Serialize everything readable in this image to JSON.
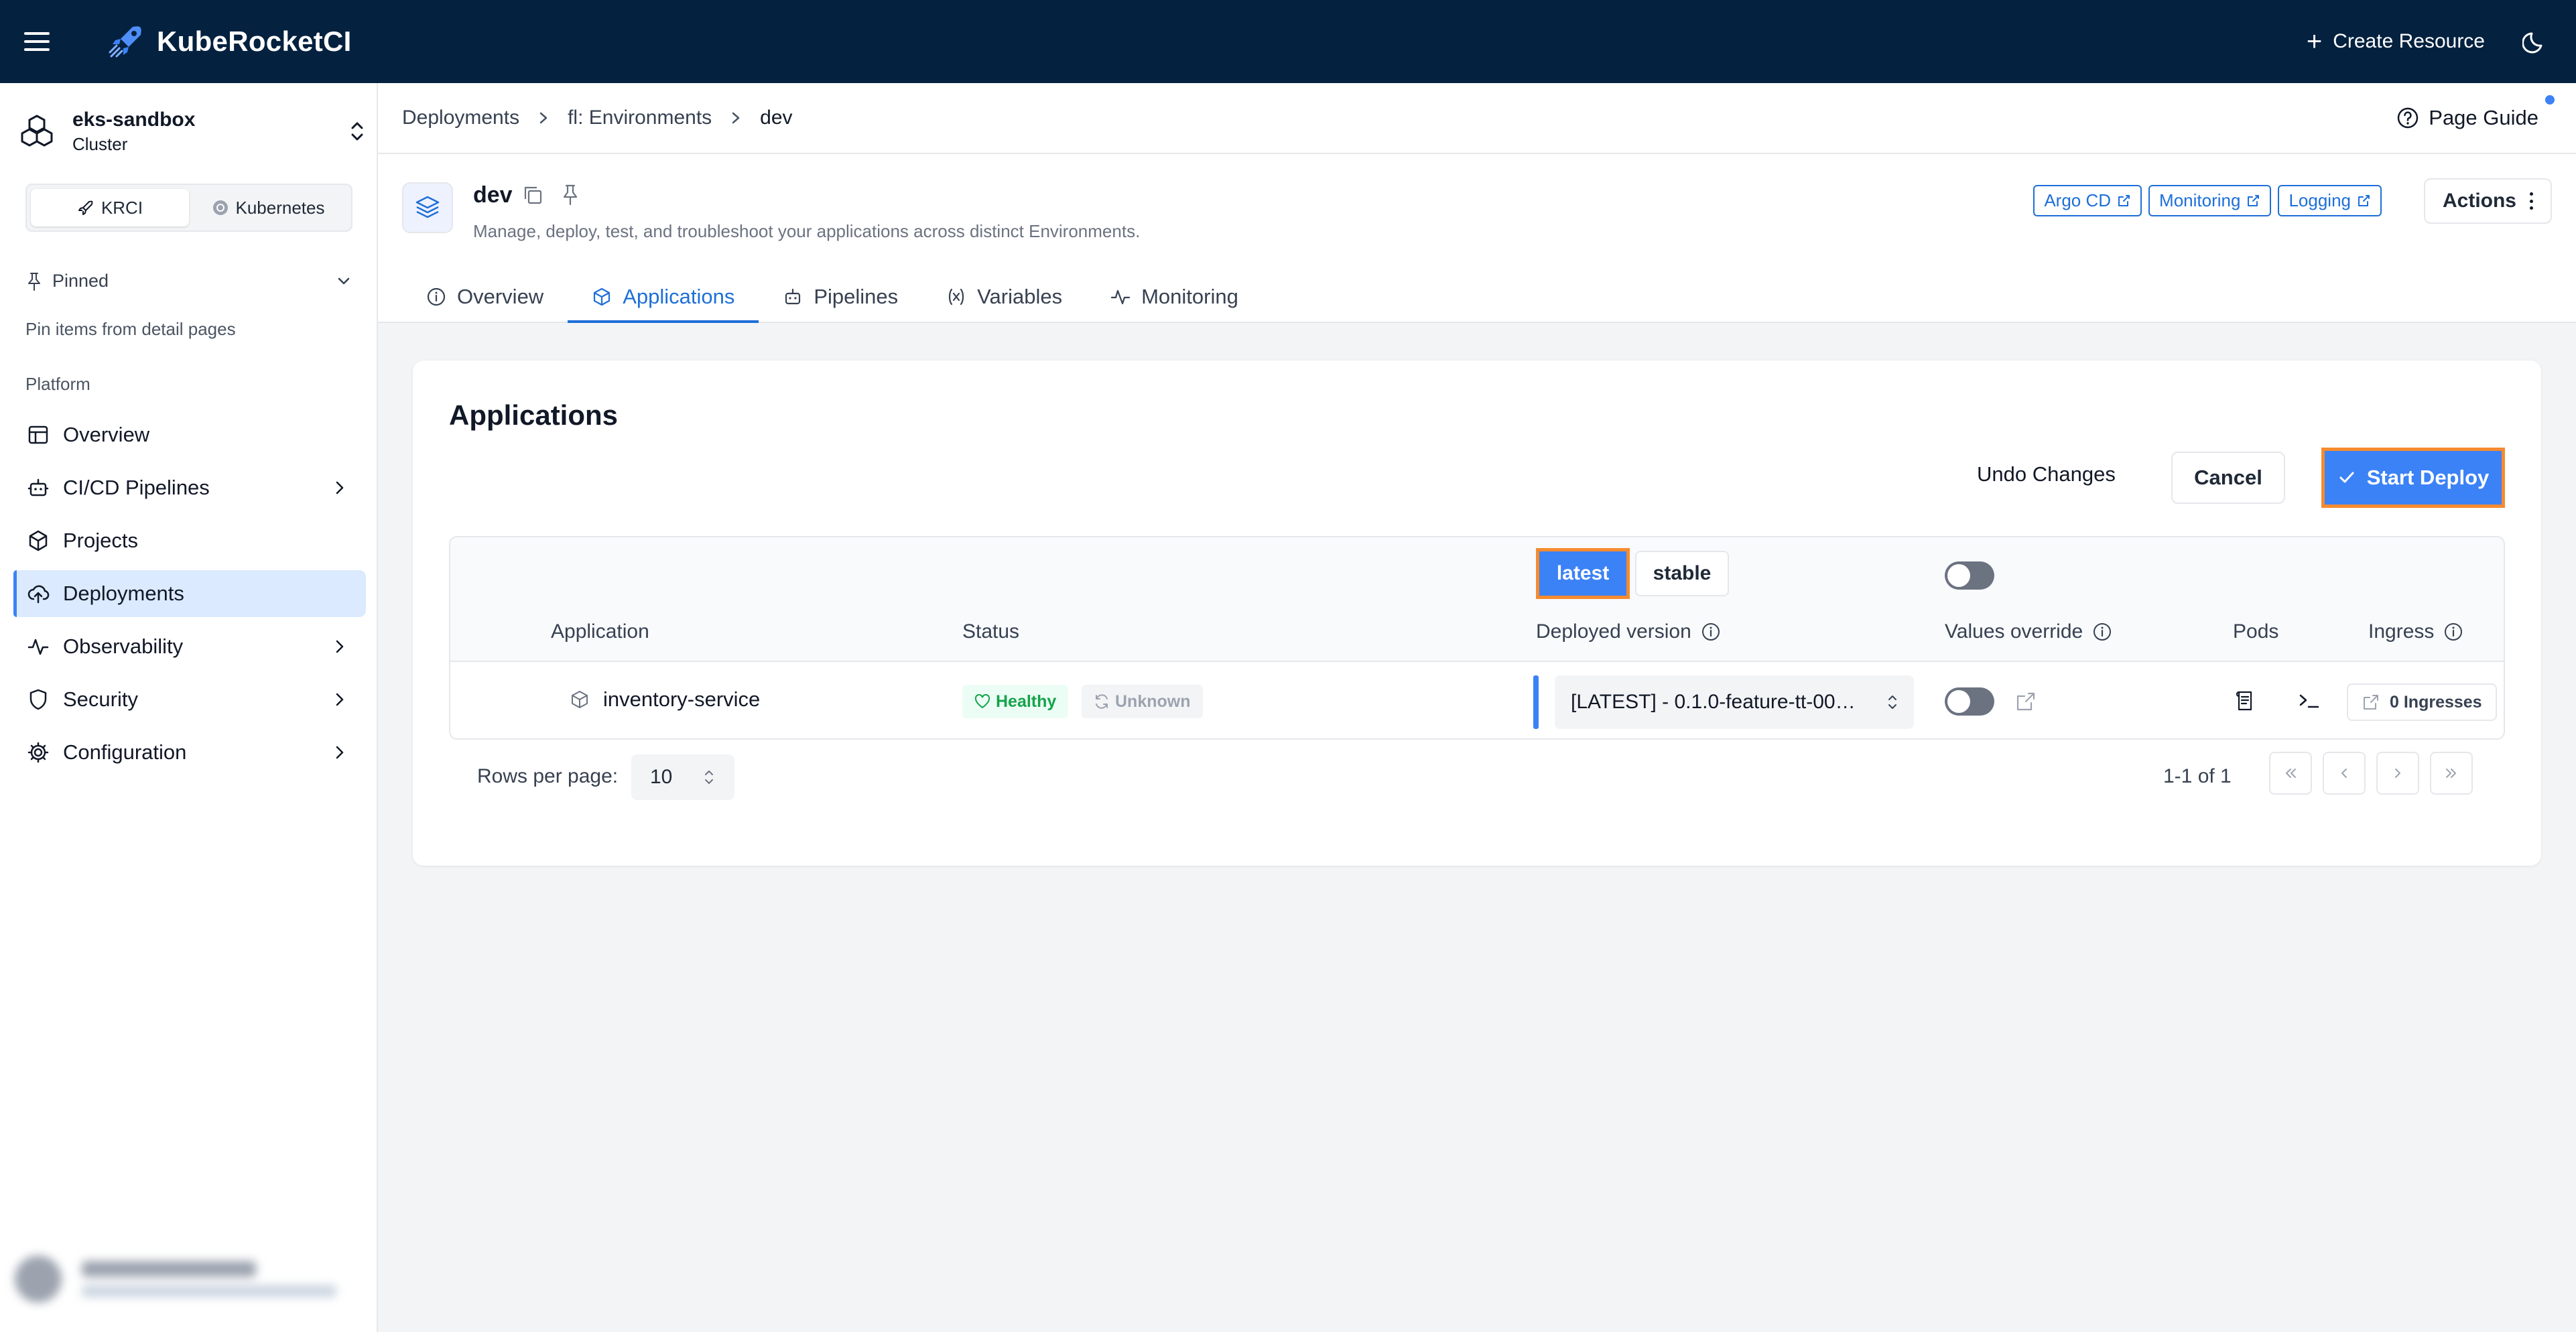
{
  "app": {
    "title": "KubeRocketCI",
    "create_label": "Create Resource"
  },
  "sidebar": {
    "cluster_name": "eks-sandbox",
    "cluster_sub": "Cluster",
    "modes": [
      {
        "label": "KRCI",
        "active": true
      },
      {
        "label": "Kubernetes",
        "active": false
      }
    ],
    "pinned_label": "Pinned",
    "pinned_hint": "Pin items from detail pages",
    "section_label": "Platform",
    "items": [
      {
        "label": "Overview",
        "icon": "layout-icon"
      },
      {
        "label": "CI/CD Pipelines",
        "icon": "bot-icon"
      },
      {
        "label": "Projects",
        "icon": "box-icon"
      },
      {
        "label": "Deployments",
        "icon": "cloud-upload-icon",
        "active": true
      },
      {
        "label": "Observability",
        "icon": "activity-icon"
      },
      {
        "label": "Security",
        "icon": "shield-icon"
      },
      {
        "label": "Configuration",
        "icon": "gear-icon"
      }
    ]
  },
  "breadcrumb": {
    "items": [
      "Deployments",
      "fl: Environments",
      "dev"
    ]
  },
  "page_guide_label": "Page Guide",
  "header": {
    "title": "dev",
    "description": "Manage, deploy, test, and troubleshoot your applications across distinct Environments.",
    "links": [
      "Argo CD",
      "Monitoring",
      "Logging"
    ],
    "actions_label": "Actions"
  },
  "tabs": [
    {
      "label": "Overview",
      "active": false
    },
    {
      "label": "Applications",
      "active": true
    },
    {
      "label": "Pipelines",
      "active": false
    },
    {
      "label": "Variables",
      "active": false
    },
    {
      "label": "Monitoring",
      "active": false
    }
  ],
  "applications": {
    "title": "Applications",
    "undo_label": "Undo Changes",
    "cancel_label": "Cancel",
    "deploy_label": "Start Deploy",
    "presets": {
      "latest": "latest",
      "stable": "stable"
    },
    "columns": {
      "application": "Application",
      "status": "Status",
      "deployed_version": "Deployed version",
      "values_override": "Values override",
      "pods": "Pods",
      "ingress": "Ingress"
    },
    "rows": [
      {
        "name": "inventory-service",
        "health": "Healthy",
        "sync": "Unknown",
        "version": "[LATEST] - 0.1.0-feature-tt-000-...",
        "ingress": "0 Ingresses"
      }
    ],
    "pagination": {
      "rows_per_page_label": "Rows per page:",
      "rows_per_page": "10",
      "range": "1-1 of 1"
    }
  },
  "colors": {
    "topbar": "#04213f",
    "accent": "#3b82f6",
    "highlight": "#f58b2f",
    "healthy": "#16a34a"
  }
}
